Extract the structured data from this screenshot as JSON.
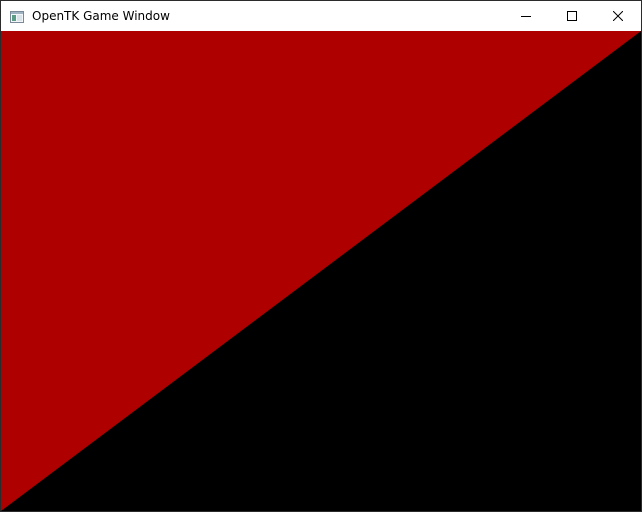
{
  "window": {
    "title": "OpenTK Game Window",
    "icon": "opentk-window-icon"
  },
  "caption_buttons": {
    "minimize": "minimize-icon",
    "maximize": "maximize-icon",
    "close": "close-icon"
  },
  "scene": {
    "background_color": "#000000",
    "triangle_color": "#af0000"
  }
}
